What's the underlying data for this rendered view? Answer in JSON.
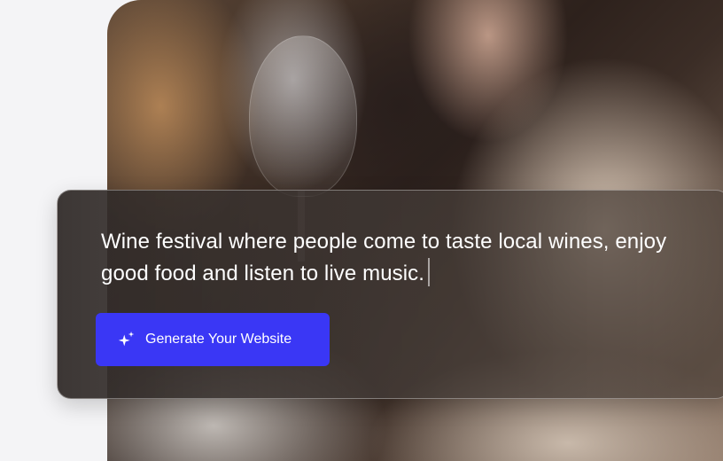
{
  "prompt": {
    "text": "Wine festival where people come to taste local wines, enjoy good food and listen to live music."
  },
  "actions": {
    "generate_label": "Generate Your Website"
  },
  "icons": {
    "generate": "sparkle-icon"
  },
  "colors": {
    "page_background": "#f4f4f6",
    "button_accent": "#3a37f5",
    "prompt_text": "#ffffff"
  }
}
